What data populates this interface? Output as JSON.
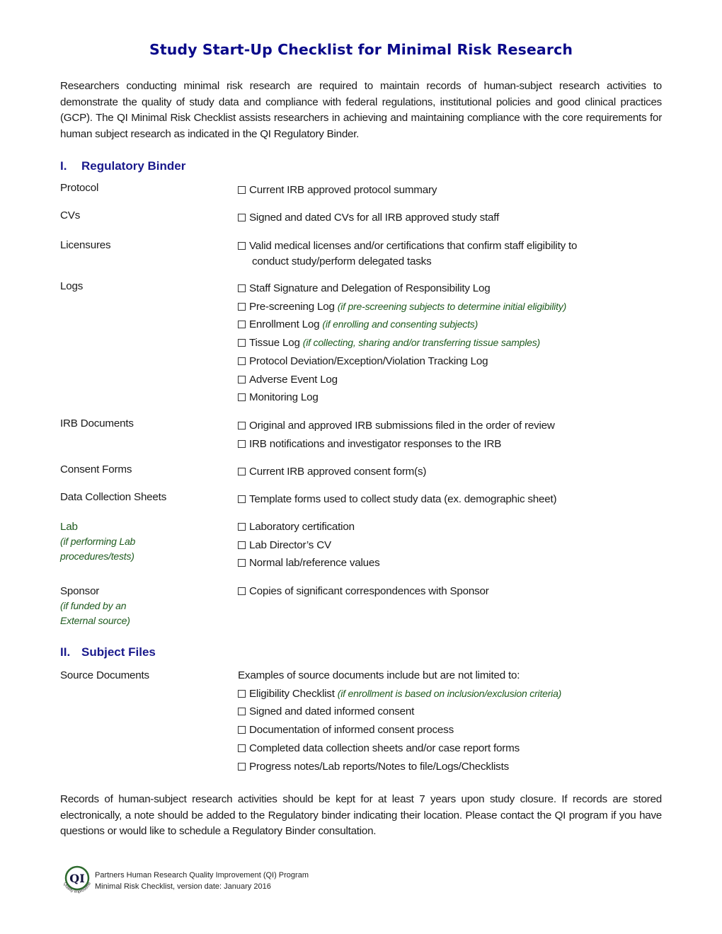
{
  "title": "Study Start-Up Checklist for Minimal Risk Research",
  "intro": "Researchers conducting minimal risk research are required to maintain records of human-subject research activities to demonstrate the quality of study data and compliance with federal regulations, institutional policies and good clinical practices (GCP).  The QI Minimal Risk Checklist assists researchers in achieving and maintaining compliance with the core requirements for human subject research as indicated in the QI Regulatory Binder.",
  "sections": [
    {
      "number": "I.",
      "heading": "Regulatory Binder",
      "rows": [
        {
          "label": "Protocol",
          "items": [
            {
              "text": "Current IRB approved protocol summary",
              "checked": false
            }
          ]
        },
        {
          "label": "CVs",
          "items": [
            {
              "text": "Signed and dated CVs for all IRB approved study staff",
              "checked": false
            }
          ]
        },
        {
          "label": "Licensures",
          "items": [
            {
              "text": "Valid medical licenses and/or certifications that confirm staff eligibility to",
              "cont": "conduct study/perform delegated tasks",
              "checked": false
            }
          ]
        },
        {
          "label": "Logs",
          "items": [
            {
              "text": "Staff Signature and Delegation of Responsibility Log",
              "checked": false
            },
            {
              "text": "Pre-screening Log",
              "condition": "(if pre-screening subjects to determine initial eligibility)",
              "checked": false
            },
            {
              "text": "Enrollment Log",
              "condition": "(if enrolling and consenting subjects)",
              "checked": false
            },
            {
              "text": "Tissue Log",
              "condition": "(if collecting, sharing and/or transferring tissue samples)",
              "checked": false
            },
            {
              "text": "Protocol Deviation/Exception/Violation Tracking Log",
              "checked": false
            },
            {
              "text": "Adverse Event Log",
              "checked": false
            },
            {
              "text": "Monitoring Log",
              "checked": false
            }
          ]
        },
        {
          "label": "IRB Documents",
          "items": [
            {
              "text": "Original and approved IRB submissions filed in the order of review",
              "checked": false
            },
            {
              "text": "IRB notifications and investigator responses to the IRB",
              "checked": false
            }
          ]
        },
        {
          "label": "Consent Forms",
          "items": [
            {
              "text": "Current IRB approved consent form(s)",
              "checked": false
            }
          ]
        },
        {
          "label": "Data Collection Sheets",
          "items": [
            {
              "text": "Template forms used to collect study data (ex. demographic sheet)",
              "checked": false
            }
          ]
        },
        {
          "label": "Lab",
          "note": [
            "(if performing Lab",
            "procedures/tests)"
          ],
          "items": [
            {
              "text": "Laboratory certification",
              "checked": false
            },
            {
              "text": "Lab Director’s CV",
              "checked": false
            },
            {
              "text": "Normal lab/reference values",
              "checked": false
            }
          ]
        },
        {
          "label": "Sponsor",
          "note": [
            "(if funded by an",
            "External source)"
          ],
          "items": [
            {
              "text": "Copies of significant correspondences with Sponsor",
              "checked": false
            }
          ]
        }
      ]
    },
    {
      "number": "II.",
      "heading": "Subject Files",
      "rows": [
        {
          "label": "Source Documents",
          "intro": "Examples of source documents include but are not limited to:",
          "items": [
            {
              "text": "Eligibility Checklist",
              "condition": "(if enrollment is based on inclusion/exclusion criteria)",
              "checked": false
            },
            {
              "text": "Signed and dated informed consent",
              "checked": false
            },
            {
              "text": "Documentation of informed consent process",
              "checked": false
            },
            {
              "text": "Completed data collection sheets and/or case report forms",
              "checked": false
            },
            {
              "text": "Progress notes/Lab reports/Notes to file/Logs/Checklists",
              "checked": false
            }
          ]
        }
      ]
    }
  ],
  "closing": "Records of human-subject research activities should be kept for at least 7 years upon study closure.   If records are stored electronically, a note should be added to the Regulatory binder indicating their location.  Please contact the QI program if you have questions or would like to schedule a Regulatory Binder consultation.",
  "footer": {
    "line1": "Partners Human Research Quality Improvement (QI) Program",
    "line2": "Minimal Risk Checklist, version date:  January 2016",
    "logo_text": "QI",
    "logo_ring_text": "Quality Improvement"
  },
  "colors": {
    "title": "#0a0a8a",
    "heading": "#1a1a8c",
    "condition_green": "#1e5a1e",
    "text": "#1a1a1a"
  }
}
